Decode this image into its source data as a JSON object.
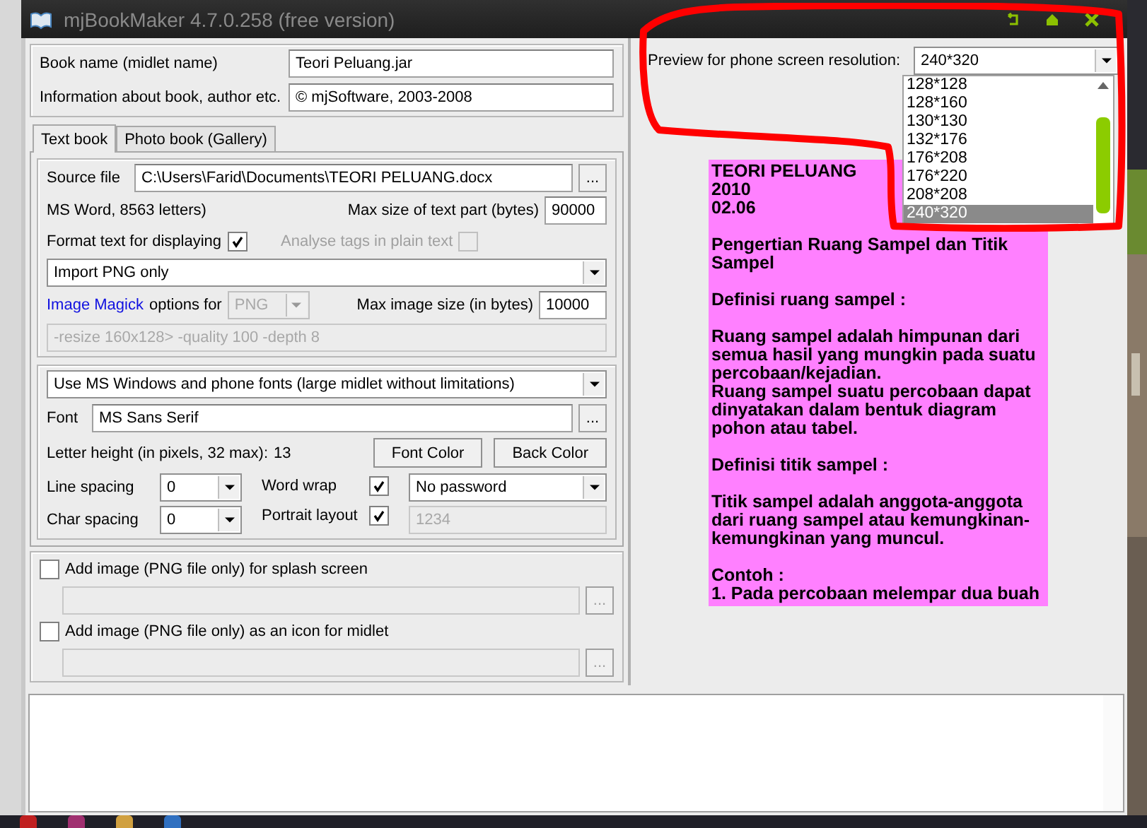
{
  "window": {
    "title": "mjBookMaker 4.7.0.258 (free version)"
  },
  "book": {
    "name_label": "Book name (midlet name)",
    "name_value": "Teori Peluang.jar",
    "info_label": "Information about book, author etc.",
    "info_value": "© mjSoftware, 2003-2008"
  },
  "tabs": [
    {
      "label": "Text book",
      "selected": true
    },
    {
      "label": "Photo book (Gallery)",
      "selected": false
    }
  ],
  "source": {
    "label": "Source file",
    "value": "C:\\Users\\Farid\\Documents\\TEORI PELUANG.docx",
    "browse": "...",
    "info": "MS Word, 8563 letters)",
    "max_label": "Max size of text part (bytes)",
    "max_value": "90000"
  },
  "options": [
    {
      "label": "Format text for displaying",
      "checked": true,
      "disabled": false
    },
    {
      "label": "Analyse tags in plain text",
      "checked": false,
      "disabled": true
    }
  ],
  "import_mode": {
    "value": "Import PNG only"
  },
  "image_magick": {
    "link": "Image Magick",
    "label": "options for",
    "format": "PNG",
    "max_label": "Max image size (in bytes)",
    "max_value": "10000",
    "args": "-resize 160x128> -quality 100 -depth 8"
  },
  "fonts": {
    "mode": "Use MS Windows and phone fonts (large midlet without limitations)",
    "font_label": "Font",
    "font_value": "MS Sans Serif",
    "browse": "...",
    "height_label": "Letter height (in pixels, 32 max):",
    "height_value": "13",
    "buttons": [
      "Font Color",
      "Back Color"
    ]
  },
  "spacing": [
    {
      "label": "Line spacing",
      "value": "0"
    },
    {
      "label": "Char spacing",
      "value": "0"
    }
  ],
  "layout_checks": [
    {
      "label": "Word wrap",
      "checked": true
    },
    {
      "label": "Portrait layout",
      "checked": true
    }
  ],
  "password": {
    "value": "No password",
    "pin": "1234"
  },
  "images": [
    {
      "label": "Add image (PNG file only) for splash screen",
      "checked": false,
      "browse": "..."
    },
    {
      "label": "Add image (PNG file only) as an icon for midlet",
      "checked": false,
      "browse": "..."
    }
  ],
  "preview": {
    "label": "Preview  for phone screen resolution:",
    "value": "240*320",
    "options": [
      {
        "label": "128*128",
        "selected": false
      },
      {
        "label": "128*160",
        "selected": false
      },
      {
        "label": "130*130",
        "selected": false
      },
      {
        "label": "132*176",
        "selected": false
      },
      {
        "label": "176*208",
        "selected": false
      },
      {
        "label": "176*220",
        "selected": false
      },
      {
        "label": "208*208",
        "selected": false
      },
      {
        "label": "240*320",
        "selected": true
      }
    ],
    "paragraphs": [
      "TEORI PELUANG\n2010\n02.06",
      "Pengertian Ruang Sampel dan Titik Sampel",
      "Definisi ruang sampel :",
      "Ruang sampel adalah himpunan dari semua hasil yang mungkin pada suatu percobaan/kejadian.\nRuang sampel suatu percobaan dapat dinyatakan dalam bentuk diagram pohon atau tabel.",
      "Definisi titik sampel :",
      "Titik sampel adalah anggota-anggota dari ruang sampel atau kemungkinan-kemungkinan yang muncul.",
      "Contoh :\n1. Pada percobaan melempar dua buah"
    ]
  }
}
